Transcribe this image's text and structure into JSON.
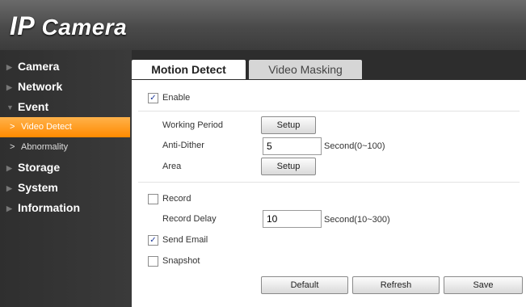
{
  "app": {
    "title_ip": "IP",
    "title_camera": " Camera"
  },
  "sidebar": {
    "items": [
      {
        "label": "Camera"
      },
      {
        "label": "Network"
      },
      {
        "label": "Event"
      },
      {
        "label": "Video Detect",
        "active": true
      },
      {
        "label": "Abnormality"
      },
      {
        "label": "Storage"
      },
      {
        "label": "System"
      },
      {
        "label": "Information"
      }
    ]
  },
  "tabs": [
    {
      "label": "Motion Detect",
      "active": true
    },
    {
      "label": "Video Masking",
      "active": false
    }
  ],
  "form": {
    "enable_label": "Enable",
    "enable_checked": true,
    "working_period_label": "Working Period",
    "working_period_button": "Setup",
    "anti_dither_label": "Anti-Dither",
    "anti_dither_value": "5",
    "anti_dither_unit": "Second(0~100)",
    "area_label": "Area",
    "area_button": "Setup",
    "record_label": "Record",
    "record_checked": false,
    "record_delay_label": "Record Delay",
    "record_delay_value": "10",
    "record_delay_unit": "Second(10~300)",
    "send_email_label": "Send Email",
    "send_email_checked": true,
    "snapshot_label": "Snapshot",
    "snapshot_checked": false
  },
  "actions": {
    "default": "Default",
    "refresh": "Refresh",
    "save": "Save"
  },
  "colors": {
    "accent": "#ff9a1a",
    "header": "#4a4a4a",
    "sidebar": "#333333"
  }
}
